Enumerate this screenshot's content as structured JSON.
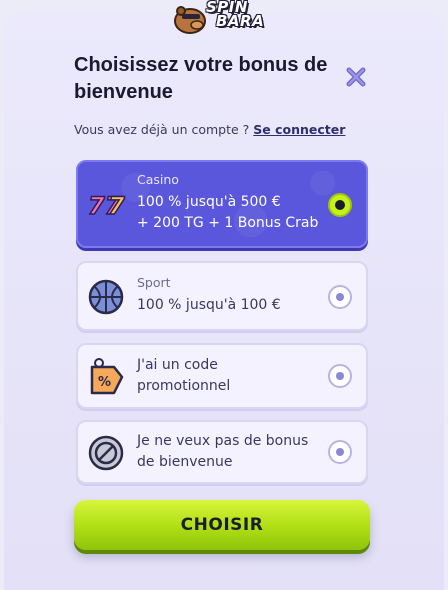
{
  "brand": {
    "logo_line1": "SPIN",
    "logo_line2": "BARA"
  },
  "modal": {
    "title": "Choisissez votre bonus de bienvenue",
    "login_prompt": "Vous avez déjà un compte ?",
    "login_link": "Se connecter"
  },
  "options": [
    {
      "label": "Casino",
      "text_line1": "100 % jusqu'à 500 €",
      "text_line2": "+ 200 TG + 1 Bonus Crab",
      "icon": "slot-777-icon",
      "selected": true
    },
    {
      "label": "Sport",
      "text_line1": "100 % jusqu'à 100 €",
      "text_line2": "",
      "icon": "basketball-icon",
      "selected": false
    },
    {
      "label": "",
      "text_line1": "J'ai un code",
      "text_line2": "promotionnel",
      "icon": "promo-tag-icon",
      "selected": false
    },
    {
      "label": "",
      "text_line1": "Je ne veux pas de bonus",
      "text_line2": "de bienvenue",
      "icon": "no-bonus-icon",
      "selected": false
    }
  ],
  "cta": {
    "label": "CHOISIR"
  },
  "colors": {
    "accent": "#5b57dc",
    "cta": "#aede14",
    "background": "#ebe9fb"
  }
}
